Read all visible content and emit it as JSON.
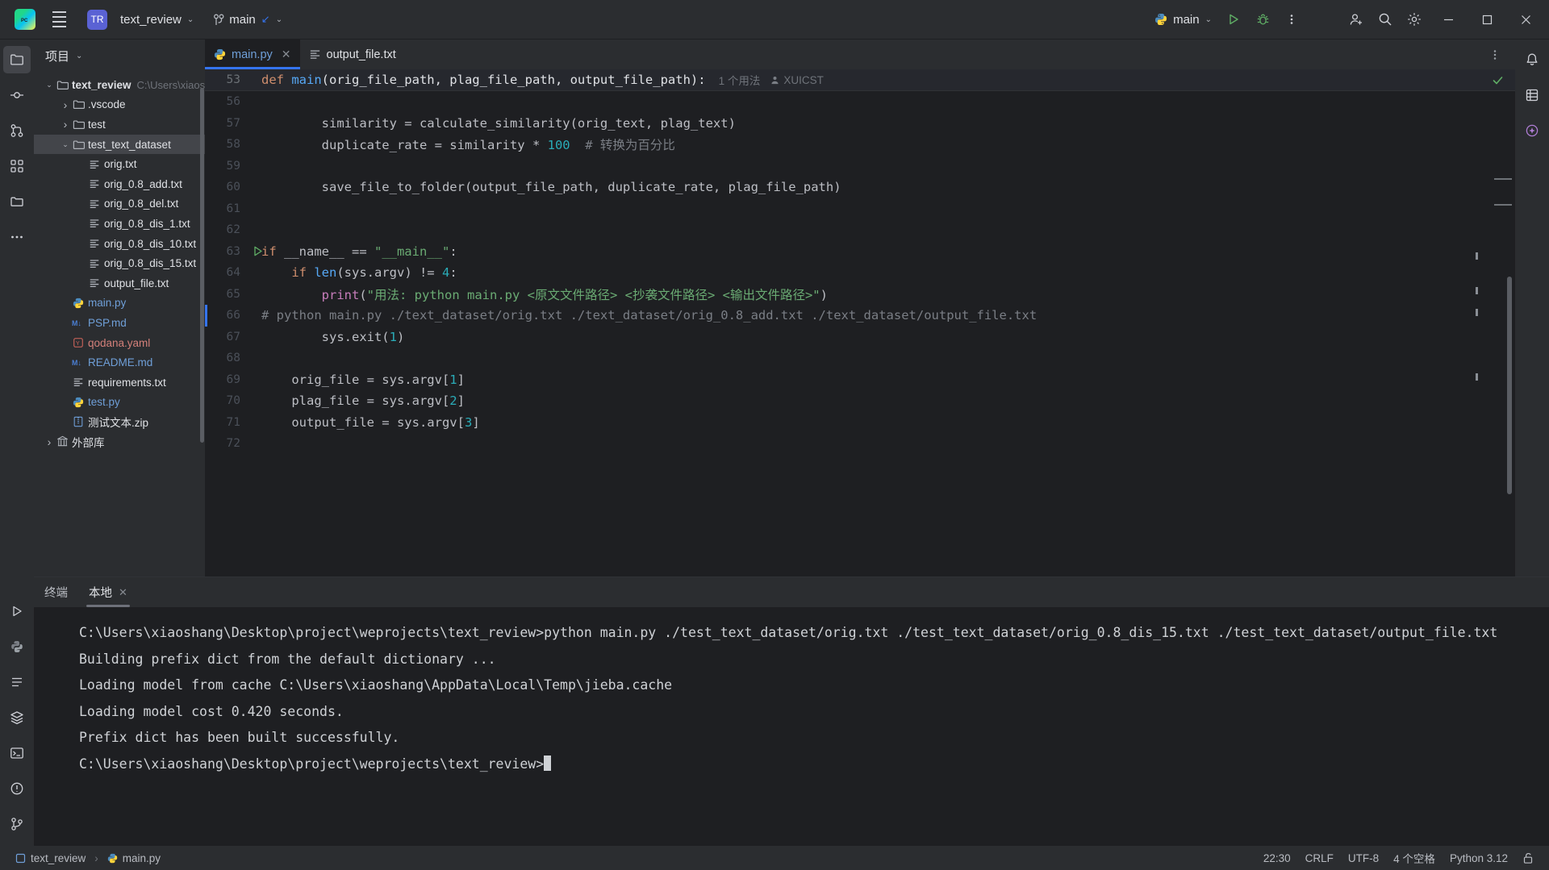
{
  "titlebar": {
    "menu_icon": "hamburger-menu-icon",
    "project_badge": "TR",
    "project_name": "text_review",
    "branch_icon": "git-branch-icon",
    "branch_name": "main",
    "run_config": "main",
    "run_icon": "run-play-icon",
    "debug_icon": "debug-bug-icon",
    "more_icon": "more-vertical-icon",
    "account_icon": "add-user-icon",
    "search_icon": "search-icon",
    "settings_icon": "gear-icon",
    "minimize_icon": "minimize-icon",
    "maximize_icon": "maximize-icon",
    "close_icon": "close-icon"
  },
  "rail_left": [
    {
      "name": "project-tool-icon",
      "active": true
    },
    {
      "name": "commit-tool-icon",
      "active": false
    },
    {
      "name": "pull-requests-icon",
      "active": false
    },
    {
      "name": "structure-icon",
      "active": false
    },
    {
      "name": "folder-icon",
      "active": false
    },
    {
      "name": "more-tools-icon",
      "active": false
    },
    {
      "name": "run-tool-icon",
      "active": false
    },
    {
      "name": "python-console-icon",
      "active": false
    },
    {
      "name": "todo-icon",
      "active": false
    },
    {
      "name": "services-icon",
      "active": false
    },
    {
      "name": "terminal-icon",
      "active": false
    },
    {
      "name": "problems-icon",
      "active": false
    },
    {
      "name": "version-control-icon",
      "active": false
    }
  ],
  "rail_right": [
    {
      "name": "notifications-bell-icon"
    },
    {
      "name": "database-icon"
    },
    {
      "name": "ai-assistant-icon"
    }
  ],
  "project_panel": {
    "title": "项目",
    "chevron": "chevron-down-icon",
    "tree": [
      {
        "indent": 0,
        "arrow": "v",
        "icon": "folder-icon",
        "label": "text_review",
        "bold": true,
        "sub": "C:\\Users\\xiaos",
        "selected": false
      },
      {
        "indent": 1,
        "arrow": ">",
        "icon": "folder-icon",
        "label": ".vscode",
        "bold": false,
        "sub": "",
        "selected": false
      },
      {
        "indent": 1,
        "arrow": ">",
        "icon": "folder-icon",
        "label": "test",
        "bold": false,
        "sub": "",
        "selected": false
      },
      {
        "indent": 1,
        "arrow": "v",
        "icon": "folder-icon",
        "label": "test_text_dataset",
        "bold": false,
        "sub": "",
        "selected": true
      },
      {
        "indent": 2,
        "arrow": "",
        "icon": "text-file-icon",
        "label": "orig.txt",
        "bold": false,
        "sub": "",
        "selected": false
      },
      {
        "indent": 2,
        "arrow": "",
        "icon": "text-file-icon",
        "label": "orig_0.8_add.txt",
        "bold": false,
        "sub": "",
        "selected": false
      },
      {
        "indent": 2,
        "arrow": "",
        "icon": "text-file-icon",
        "label": "orig_0.8_del.txt",
        "bold": false,
        "sub": "",
        "selected": false
      },
      {
        "indent": 2,
        "arrow": "",
        "icon": "text-file-icon",
        "label": "orig_0.8_dis_1.txt",
        "bold": false,
        "sub": "",
        "selected": false
      },
      {
        "indent": 2,
        "arrow": "",
        "icon": "text-file-icon",
        "label": "orig_0.8_dis_10.txt",
        "bold": false,
        "sub": "",
        "selected": false
      },
      {
        "indent": 2,
        "arrow": "",
        "icon": "text-file-icon",
        "label": "orig_0.8_dis_15.txt",
        "bold": false,
        "sub": "",
        "selected": false
      },
      {
        "indent": 2,
        "arrow": "",
        "icon": "text-file-icon",
        "label": "output_file.txt",
        "bold": false,
        "sub": "",
        "selected": false
      },
      {
        "indent": 1,
        "arrow": "",
        "icon": "python-file-icon",
        "label": "main.py",
        "bold": false,
        "sub": "",
        "selected": false
      },
      {
        "indent": 1,
        "arrow": "",
        "icon": "markdown-file-icon",
        "label": "PSP.md",
        "bold": false,
        "sub": "",
        "selected": false
      },
      {
        "indent": 1,
        "arrow": "",
        "icon": "yaml-file-icon",
        "label": "qodana.yaml",
        "bold": false,
        "sub": "",
        "selected": false
      },
      {
        "indent": 1,
        "arrow": "",
        "icon": "markdown-file-icon",
        "label": "README.md",
        "bold": false,
        "sub": "",
        "selected": false
      },
      {
        "indent": 1,
        "arrow": "",
        "icon": "text-file-icon",
        "label": "requirements.txt",
        "bold": false,
        "sub": "",
        "selected": false
      },
      {
        "indent": 1,
        "arrow": "",
        "icon": "python-file-icon",
        "label": "test.py",
        "bold": false,
        "sub": "",
        "selected": false
      },
      {
        "indent": 1,
        "arrow": "",
        "icon": "archive-file-icon",
        "label": "测试文本.zip",
        "bold": false,
        "sub": "",
        "selected": false
      },
      {
        "indent": 0,
        "arrow": ">",
        "icon": "library-icon",
        "label": "外部库",
        "bold": false,
        "sub": "",
        "selected": false
      }
    ]
  },
  "editor": {
    "tabs": [
      {
        "label": "main.py",
        "icon": "python-file-icon",
        "active": true,
        "closable": true
      },
      {
        "label": "output_file.txt",
        "icon": "text-file-icon",
        "active": false,
        "closable": false
      }
    ],
    "tab_options_icon": "more-vertical-icon",
    "sticky": {
      "line_no": "53",
      "code_prefix": "def ",
      "code_fn": "main",
      "code_args": "(orig_file_path, plag_file_path, output_file_path):",
      "usage": "1 个用法",
      "author": "XUICST",
      "author_icon": "person-icon",
      "inspect_icon": "checkmark-icon"
    },
    "lines": [
      {
        "no": "56",
        "indent": 0,
        "tokens": []
      },
      {
        "no": "57",
        "indent": 8,
        "tokens": [
          {
            "t": "similarity = calculate_similarity(orig_text, plag_text)",
            "c": ""
          }
        ]
      },
      {
        "no": "58",
        "indent": 8,
        "tokens": [
          {
            "t": "duplicate_rate = similarity * ",
            "c": ""
          },
          {
            "t": "100",
            "c": "num"
          },
          {
            "t": "  # 转换为百分比",
            "c": "cmt"
          }
        ]
      },
      {
        "no": "59",
        "indent": 0,
        "tokens": []
      },
      {
        "no": "60",
        "indent": 8,
        "tokens": [
          {
            "t": "save_file_to_folder(output_file_path, duplicate_rate, plag_file_path)",
            "c": ""
          }
        ]
      },
      {
        "no": "61",
        "indent": 0,
        "tokens": []
      },
      {
        "no": "62",
        "indent": 0,
        "tokens": []
      },
      {
        "no": "63",
        "indent": 0,
        "runmark": true,
        "tokens": [
          {
            "t": "if ",
            "c": "k"
          },
          {
            "t": "__name__ ",
            "c": ""
          },
          {
            "t": "== ",
            "c": ""
          },
          {
            "t": "\"__main__\"",
            "c": "str"
          },
          {
            "t": ":",
            "c": ""
          }
        ]
      },
      {
        "no": "64",
        "indent": 4,
        "tokens": [
          {
            "t": "if ",
            "c": "k"
          },
          {
            "t": "len",
            "c": "fn"
          },
          {
            "t": "(sys.argv) != ",
            "c": ""
          },
          {
            "t": "4",
            "c": "num"
          },
          {
            "t": ":",
            "c": ""
          }
        ]
      },
      {
        "no": "65",
        "indent": 8,
        "tokens": [
          {
            "t": "print",
            "c": "vdef"
          },
          {
            "t": "(",
            "c": ""
          },
          {
            "t": "\"用法: python main.py <原文文件路径> <抄袭文件路径> <输出文件路径>\"",
            "c": "str"
          },
          {
            "t": ")",
            "c": ""
          }
        ]
      },
      {
        "no": "66",
        "indent": 0,
        "marked": true,
        "tokens": [
          {
            "t": "# python main.py ./text_dataset/orig.txt ./text_dataset/orig_0.8_add.txt ./text_dataset/output_file.txt",
            "c": "cmt"
          }
        ]
      },
      {
        "no": "67",
        "indent": 8,
        "tokens": [
          {
            "t": "sys.exit(",
            "c": ""
          },
          {
            "t": "1",
            "c": "num"
          },
          {
            "t": ")",
            "c": ""
          }
        ]
      },
      {
        "no": "68",
        "indent": 0,
        "tokens": []
      },
      {
        "no": "69",
        "indent": 4,
        "tokens": [
          {
            "t": "orig_file = sys.argv[",
            "c": ""
          },
          {
            "t": "1",
            "c": "num"
          },
          {
            "t": "]",
            "c": ""
          }
        ]
      },
      {
        "no": "70",
        "indent": 4,
        "tokens": [
          {
            "t": "plag_file = sys.argv[",
            "c": ""
          },
          {
            "t": "2",
            "c": "num"
          },
          {
            "t": "]",
            "c": ""
          }
        ]
      },
      {
        "no": "71",
        "indent": 4,
        "tokens": [
          {
            "t": "output_file = sys.argv[",
            "c": ""
          },
          {
            "t": "3",
            "c": "num"
          },
          {
            "t": "]",
            "c": ""
          }
        ]
      },
      {
        "no": "72",
        "indent": 0,
        "tokens": []
      }
    ]
  },
  "terminal": {
    "tabs": [
      {
        "label": "终端",
        "active": false,
        "closable": false
      },
      {
        "label": "本地",
        "active": true,
        "closable": true
      }
    ],
    "close_icon": "close-icon",
    "output": "C:\\Users\\xiaoshang\\Desktop\\project\\weprojects\\text_review>python main.py ./test_text_dataset/orig.txt ./test_text_dataset/orig_0.8_dis_15.txt ./test_text_dataset/output_file.txt\nBuilding prefix dict from the default dictionary ...\nLoading model from cache C:\\Users\\xiaoshang\\AppData\\Local\\Temp\\jieba.cache\nLoading model cost 0.420 seconds.\nPrefix dict has been built successfully.\n",
    "prompt": "C:\\Users\\xiaoshang\\Desktop\\project\\weprojects\\text_review>"
  },
  "statusbar": {
    "breadcrumb_project": "text_review",
    "breadcrumb_project_icon": "module-icon",
    "breadcrumb_sep": "›",
    "breadcrumb_file": "main.py",
    "breadcrumb_file_icon": "python-file-icon",
    "position": "22:30",
    "line_sep": "CRLF",
    "encoding": "UTF-8",
    "indent": "4 个空格",
    "interpreter": "Python 3.12",
    "lock_icon": "unlocked-padlock-icon"
  },
  "colors": {
    "accent_blue": "#3574f0",
    "bg_dark": "#1e1f22",
    "bg_panel": "#2b2d30",
    "selection": "#43454a",
    "green": "#5fad65",
    "string_green": "#6aab73",
    "keyword_orange": "#cf8e6d",
    "number_cyan": "#2aacb8",
    "comment_gray": "#7a7e85"
  }
}
